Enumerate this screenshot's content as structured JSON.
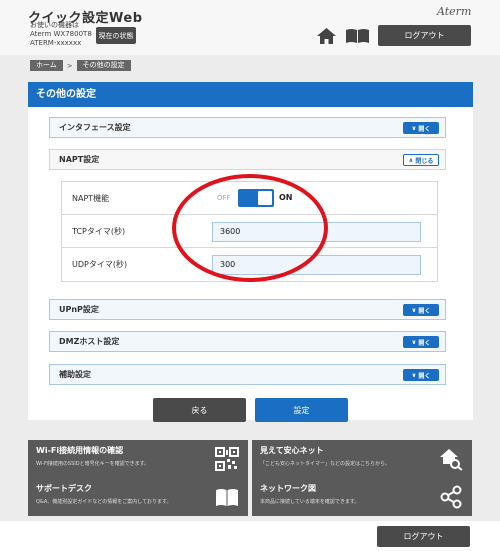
{
  "header": {
    "app_title": "クイック設定Web",
    "device_line1": "お使いの機器は",
    "device_line2": "Aterm WX7800T8",
    "device_line3": "ATERM-xxxxxx",
    "status_button": "現在の状態",
    "brand": "Aterm",
    "home_icon": "home-icon",
    "manual_icon": "book-icon",
    "logout_label": "ログアウト"
  },
  "breadcrumb": {
    "home": "ホーム",
    "separator": ">",
    "current": "その他の設定"
  },
  "page": {
    "title": "その他の設定",
    "accent_color": "#1a6fc4"
  },
  "sections": {
    "interface": {
      "label": "インタフェース設定",
      "toggle": "開く"
    },
    "napt": {
      "label": "NAPT設定",
      "toggle": "閉じる"
    },
    "upnp": {
      "label": "UPnP設定",
      "toggle": "開く"
    },
    "dmz": {
      "label": "DMZホスト設定",
      "toggle": "開く"
    },
    "aux": {
      "label": "補助設定",
      "toggle": "開く"
    }
  },
  "napt": {
    "function_label": "NAPT機能",
    "toggle_off": "OFF",
    "toggle_on": "ON",
    "toggle_state": "ON",
    "tcp_label": "TCPタイマ(秒)",
    "tcp_value": "3600",
    "udp_label": "UDPタイマ(秒)",
    "udp_value": "300"
  },
  "actions": {
    "back": "戻る",
    "set": "設定"
  },
  "cards": {
    "wifi": {
      "title": "Wi-Fi接続用情報の確認",
      "desc": "Wi-Fi接続用のSSIDと暗号化キーを確認できます。",
      "icon": "qr-code-icon"
    },
    "safety": {
      "title": "見えて安心ネット",
      "desc": "「こども安心ネットタイマー」などの設定はこちらから。",
      "icon": "home-search-icon"
    },
    "support": {
      "title": "サポートデスク",
      "desc": "Q&A、機能別設定ガイドなどの情報をご案内しております。",
      "icon": "book-icon"
    },
    "network": {
      "title": "ネットワーク図",
      "desc": "本商品に接続している端末を確認できます。",
      "icon": "share-icon"
    }
  },
  "footer": {
    "logout_label": "ログアウト"
  }
}
